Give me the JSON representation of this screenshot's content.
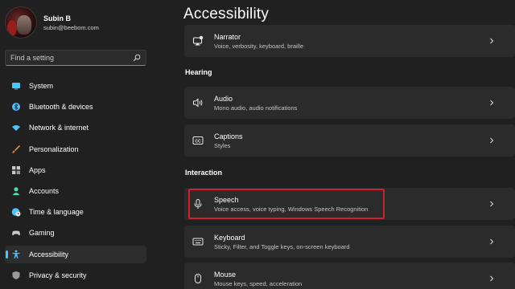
{
  "profile": {
    "name": "Subin B",
    "email": "subin@beebom.com"
  },
  "search": {
    "placeholder": "Find a setting"
  },
  "sidebar": {
    "items": [
      {
        "label": "System",
        "icon": "monitor-icon",
        "color": "#4cc2ff"
      },
      {
        "label": "Bluetooth & devices",
        "icon": "bluetooth-icon",
        "color": "#4cc2ff"
      },
      {
        "label": "Network & internet",
        "icon": "wifi-icon",
        "color": "#4cc2ff"
      },
      {
        "label": "Personalization",
        "icon": "brush-icon",
        "color": "#f0a05a"
      },
      {
        "label": "Apps",
        "icon": "apps-icon",
        "color": "#c8c8c8"
      },
      {
        "label": "Accounts",
        "icon": "person-icon",
        "color": "#4cd9a5"
      },
      {
        "label": "Time & language",
        "icon": "globe-clock-icon",
        "color": "#4cc2ff"
      },
      {
        "label": "Gaming",
        "icon": "gamepad-icon",
        "color": "#c8c8c8"
      },
      {
        "label": "Accessibility",
        "icon": "accessibility-icon",
        "color": "#4cc2ff",
        "active": true
      },
      {
        "label": "Privacy & security",
        "icon": "shield-icon",
        "color": "#9a9a9a"
      }
    ]
  },
  "main": {
    "title": "Accessibility",
    "cards": {
      "narrator": {
        "title": "Narrator",
        "subtitle": "Voice, verbosity, keyboard, braille"
      },
      "audio": {
        "title": "Audio",
        "subtitle": "Mono audio, audio notifications"
      },
      "captions": {
        "title": "Captions",
        "subtitle": "Styles"
      },
      "speech": {
        "title": "Speech",
        "subtitle": "Voice access, voice typing, Windows Speech Recognition"
      },
      "keyboard": {
        "title": "Keyboard",
        "subtitle": "Sticky, Filter, and Toggle keys, on-screen keyboard"
      },
      "mouse": {
        "title": "Mouse",
        "subtitle": "Mouse keys, speed, acceleration"
      }
    },
    "sections": {
      "hearing": "Hearing",
      "interaction": "Interaction"
    }
  },
  "colors": {
    "accent": "#4cc2ff",
    "highlight": "#d0202a"
  }
}
